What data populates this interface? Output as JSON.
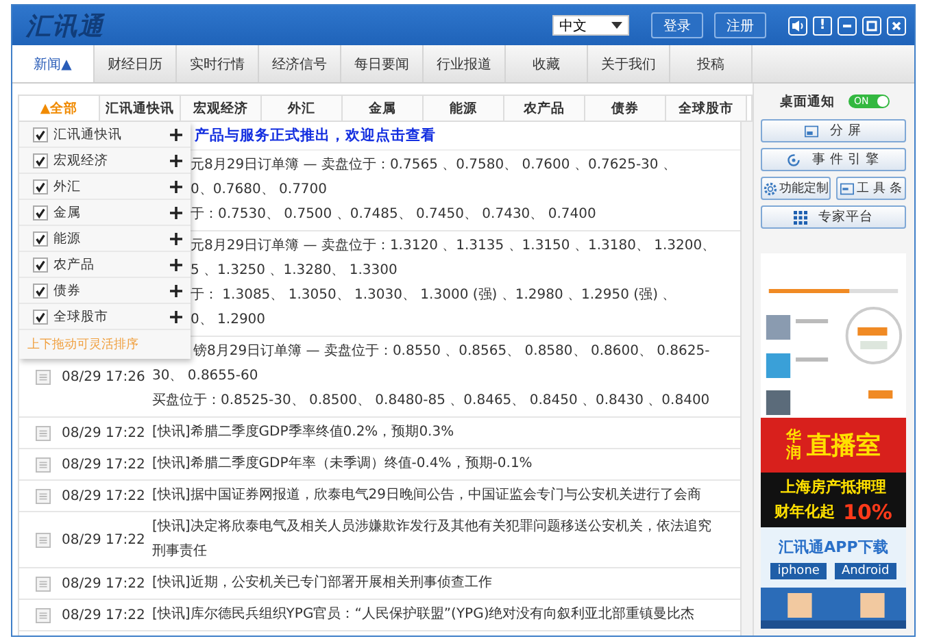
{
  "window": {
    "logo": "汇讯通",
    "language": "中文",
    "buttons": [
      "登录",
      "注册"
    ],
    "controls": [
      {
        "kind": "sound"
      },
      {
        "kind": "alert",
        "label": "!"
      },
      {
        "kind": "minimize"
      },
      {
        "kind": "maximize"
      },
      {
        "kind": "close"
      }
    ]
  },
  "tabs": [
    {
      "label": "新闻",
      "arrow": "▲",
      "selected": true
    },
    {
      "label": "财经日历",
      "selected": false
    },
    {
      "label": "实时行情",
      "selected": false
    },
    {
      "label": "经济信号",
      "selected": false
    },
    {
      "label": "每日要闻",
      "selected": false
    },
    {
      "label": "行业报道",
      "selected": false
    },
    {
      "label": "收藏",
      "selected": false
    },
    {
      "label": "关于我们",
      "selected": false
    },
    {
      "label": "投稿",
      "selected": false
    }
  ],
  "categories": [
    {
      "label": "全部",
      "arrow": "▲",
      "selected": true
    },
    {
      "label": "汇讯通快讯",
      "selected": false
    },
    {
      "label": "宏观经济",
      "selected": false
    },
    {
      "label": "外汇",
      "selected": false
    },
    {
      "label": "金属",
      "selected": false
    },
    {
      "label": "能源",
      "selected": false
    },
    {
      "label": "农产品",
      "selected": false
    },
    {
      "label": "债券",
      "selected": false
    },
    {
      "label": "全球股市",
      "selected": false
    }
  ],
  "category_menu": {
    "items": [
      {
        "label": "汇讯通快讯",
        "checked": true
      },
      {
        "label": "宏观经济",
        "checked": true
      },
      {
        "label": "外汇",
        "checked": true
      },
      {
        "label": "金属",
        "checked": true
      },
      {
        "label": "能源",
        "checked": true
      },
      {
        "label": "农产品",
        "checked": true
      },
      {
        "label": "债券",
        "checked": true
      },
      {
        "label": "全球股市",
        "checked": true
      }
    ],
    "hint": "上下拖动可灵活排序"
  },
  "headline": "产品与服务正式推出，欢迎点击查看",
  "partly_hidden_rows": [
    {
      "lines": [
        "元8月29日订单簿 — 卖盘位于：0.7565 、0.7580、 0.7600 、0.7625-30 、",
        "0、0.7680、 0.7700",
        "于：0.7530、 0.7500 、0.7485、 0.7450、 0.7430、 0.7400"
      ]
    },
    {
      "lines": [
        "元8月29日订单簿 — 卖盘位于：1.3120 、1.3135 、1.3150 、1.3180、 1.3200、",
        "5 、1.3250 、1.3280、 1.3300",
        "于： 1.3085、 1.3050、 1.3030、 1.3000 (强) 、1.2980 、1.2950 (强) 、",
        "0、 1.2900"
      ]
    }
  ],
  "rows": [
    {
      "time": "08/29 17:26",
      "lines": [
        "镑8月29日订单簿 — 卖盘位于：0.8550 、0.8565、 0.8580、 0.8600、 0.8625-",
        "30、 0.8655-60",
        "买盘位于：0.8525-30、 0.8500、 0.8480-85 、0.8465、 0.8450 、0.8430 、0.8400"
      ]
    },
    {
      "time": "08/29 17:22",
      "lines": [
        "[快讯]希腊二季度GDP季率终值0.2%，预期0.3%"
      ]
    },
    {
      "time": "08/29 17:22",
      "lines": [
        "[快讯]希腊二季度GDP年率（未季调）终值-0.4%，预期-0.1%"
      ]
    },
    {
      "time": "08/29 17:22",
      "lines": [
        "[快讯]据中国证券网报道，欣泰电气29日晚间公告，中国证监会专门与公安机关进行了会商"
      ]
    },
    {
      "time": "08/29 17:22",
      "lines": [
        "[快讯]决定将欣泰电气及相关人员涉嫌欺诈发行及其他有关犯罪问题移送公安机关，依法追究",
        "刑事责任"
      ]
    },
    {
      "time": "08/29 17:22",
      "lines": [
        "[快讯]近期，公安机关已专门部署开展相关刑事侦查工作"
      ]
    },
    {
      "time": "08/29 17:22",
      "lines": [
        "[快讯]库尔德民兵组织YPG官员：“人民保护联盟”(YPG)绝对没有向叙利亚北部重镇曼比杰"
      ]
    }
  ],
  "sidebar": {
    "notify": {
      "label": "桌面通知",
      "toggle": "ON",
      "on": true
    },
    "buttons": [
      {
        "kind": "wide",
        "label": "分 屏"
      },
      {
        "kind": "wide",
        "label": "事 件 引 擎"
      },
      {
        "kind": "half",
        "label": "功能定制"
      },
      {
        "kind": "half",
        "label": "工 具 条"
      },
      {
        "kind": "wide",
        "label": "专家平台"
      }
    ],
    "banners": [
      {
        "kind": "live",
        "lines": [
          "华润",
          "直播室"
        ]
      },
      {
        "kind": "loan",
        "lines": [
          "上海房产抵押理",
          "财年化起",
          "10%"
        ]
      },
      {
        "kind": "app",
        "lines": [
          "汇讯通APP下载",
          "iphone",
          "Android"
        ]
      }
    ]
  }
}
